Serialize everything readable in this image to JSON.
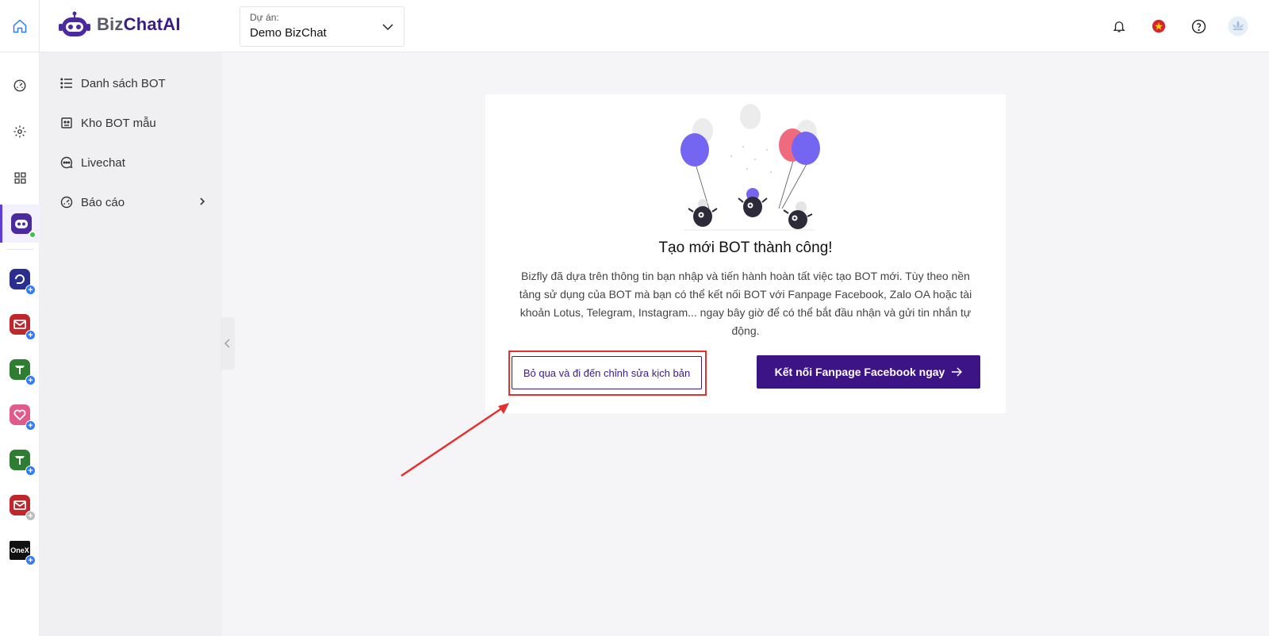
{
  "header": {
    "logo_biz": "Biz",
    "logo_chat": "ChatAI",
    "project_label": "Dự án:",
    "project_value": "Demo BizChat"
  },
  "rail": {
    "apps": [
      {
        "icon": "bizchat-bot-icon",
        "color": "#4b2aa0"
      },
      {
        "icon": "app-blue-icon",
        "color": "#2a2f8f"
      },
      {
        "icon": "mail-app-icon",
        "color": "#c0272d"
      },
      {
        "icon": "t-app-icon",
        "color": "#2e7d32"
      },
      {
        "icon": "heart-app-icon",
        "color": "#e05a8a"
      },
      {
        "icon": "t-app-icon",
        "color": "#2e7d32"
      },
      {
        "icon": "mail-app-icon",
        "color": "#c0272d"
      },
      {
        "icon": "onex-app-icon",
        "color": "#111111",
        "label": "OneX"
      }
    ]
  },
  "sidebar": {
    "items": [
      {
        "label": "Danh sách BOT",
        "icon": "list-icon"
      },
      {
        "label": "Kho BOT mẫu",
        "icon": "bot-template-icon"
      },
      {
        "label": "Livechat",
        "icon": "chat-bubble-icon"
      },
      {
        "label": "Báo cáo",
        "icon": "dashboard-gauge-icon"
      }
    ]
  },
  "card": {
    "title": "Tạo mới BOT thành công!",
    "description": "Bizfly đã dựa trên thông tin bạn nhập và tiến hành hoàn tất việc tạo BOT mới. Tùy theo nền tảng sử dụng của BOT mà bạn có thể kết nối BOT với Fanpage Facebook, Zalo OA hoặc tài khoản Lotus, Telegram, Instagram... ngay bây giờ để có thể bắt đầu nhận và gửi tin nhắn tự động.",
    "skip_label": "Bỏ qua và đi đến chỉnh sửa kịch bản",
    "connect_label": "Kết nối Fanpage Facebook ngay"
  },
  "colors": {
    "brand": "#3d1485",
    "accent": "#5b3fd6",
    "annotation": "#e53030"
  }
}
